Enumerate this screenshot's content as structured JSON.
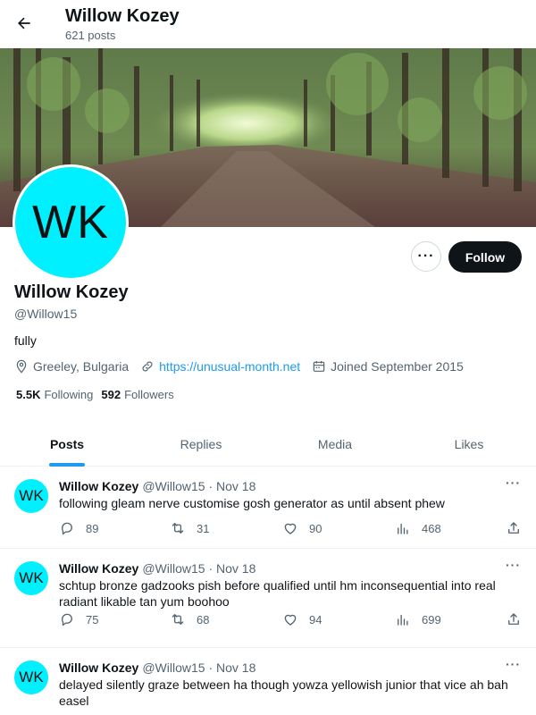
{
  "header": {
    "title": "Willow Kozey",
    "posts_count": "621 posts"
  },
  "profile": {
    "avatar_initials": "WK",
    "avatar_color": "#00f0ff",
    "name": "Willow Kozey",
    "handle": "@Willow15",
    "bio": "fully",
    "location": "Greeley, Bulgaria",
    "website": "https://unusual-month.net",
    "joined": "Joined September 2015",
    "following_count": "5.5K",
    "following_label": "Following",
    "followers_count": "592",
    "followers_label": "Followers",
    "more_label": "···",
    "follow_label": "Follow"
  },
  "tabs": [
    "Posts",
    "Replies",
    "Media",
    "Likes"
  ],
  "tweets": [
    {
      "avatar": "WK",
      "name": "Willow Kozey",
      "handle": "@Willow15 · Nov 18",
      "text": "following gleam nerve customise gosh generator as until absent phew",
      "replies": "89",
      "retweets": "31",
      "likes": "90",
      "views": "468"
    },
    {
      "avatar": "WK",
      "name": "Willow Kozey",
      "handle": "@Willow15 · Nov 18",
      "text": "schtup bronze gadzooks pish before qualified until hm inconsequential into real radiant likable tan yum boohoo",
      "replies": "75",
      "retweets": "68",
      "likes": "94",
      "views": "699"
    },
    {
      "avatar": "WK",
      "name": "Willow Kozey",
      "handle": "@Willow15 · Nov 18",
      "text": "delayed silently graze between ha though yowza yellowish junior that vice ah bah easel",
      "replies": "",
      "retweets": "",
      "likes": "",
      "views": ""
    }
  ],
  "tweet_more_label": "···",
  "colors": {
    "accent": "#1d9bf0",
    "follow_bg": "#0f1419"
  },
  "icons": [
    "back-arrow-icon",
    "location-icon",
    "link-icon",
    "calendar-icon",
    "reply-icon",
    "retweet-icon",
    "like-icon",
    "views-icon",
    "share-icon"
  ]
}
